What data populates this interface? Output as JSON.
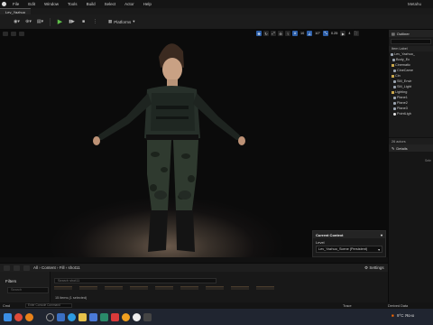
{
  "app": {
    "title": "Metahu",
    "menu": [
      "File",
      "Edit",
      "Window",
      "Tools",
      "Build",
      "Select",
      "Actor",
      "Help"
    ]
  },
  "tabs": [
    {
      "label": "Lev_Yazhuo"
    }
  ],
  "toolbar": {
    "platforms_label": "Platforms",
    "icons": [
      "select-mode-icon",
      "add-actor-icon",
      "blueprint-icon",
      "play-icon",
      "step-icon",
      "stop-icon",
      "more-icon"
    ]
  },
  "viewport": {
    "controls": {
      "grid_snap": "10",
      "rotation_snap": "10°",
      "scale_snap": "0.25",
      "camera_speed": "4"
    },
    "context": {
      "title": "Current Context",
      "level_label": "Level",
      "level_value": "Lev_Yazhuo_Scene (Persistent)"
    }
  },
  "outliner": {
    "title": "Outliner",
    "column": "Item Label",
    "items": [
      {
        "label": "Lev_Yazhuo_",
        "icon": "actor",
        "indent": 2
      },
      {
        "label": "Body_Ec",
        "icon": "actor",
        "indent": 4
      },
      {
        "label": "Cinematic",
        "icon": "folder",
        "indent": 3
      },
      {
        "label": "CineCame",
        "icon": "actor",
        "indent": 5
      },
      {
        "label": "Cin",
        "icon": "folder",
        "indent": 3
      },
      {
        "label": "SM_Envir",
        "icon": "actor",
        "indent": 5
      },
      {
        "label": "SM_Light",
        "icon": "actor",
        "indent": 5
      },
      {
        "label": "Lighting",
        "icon": "folder",
        "indent": 3
      },
      {
        "label": "Plane1",
        "icon": "actor",
        "indent": 5
      },
      {
        "label": "Plane2",
        "icon": "actor",
        "indent": 5
      },
      {
        "label": "Plane3",
        "icon": "actor",
        "indent": 5
      },
      {
        "label": "PointLigh",
        "icon": "light",
        "indent": 5
      }
    ],
    "footer": "26 actors"
  },
  "details": {
    "title": "Details",
    "note": "Sele"
  },
  "content_browser": {
    "path": [
      "All",
      "Content",
      "Fill",
      "shot11"
    ],
    "settings_label": "Settings",
    "filters_label": "Filters",
    "filter_search_placeholder": "Search",
    "search_placeholder": "Search shot11",
    "count": "15 items (1 selected)"
  },
  "statusbar": {
    "left": "Cmd",
    "cmd_placeholder": "Enter Console Command",
    "trace": "Trace",
    "derived": "Derived Data"
  },
  "taskbar": {
    "temperature": "9°C",
    "weather": "Ясно",
    "warn": "■"
  },
  "colors": {
    "accent": "#2d5fa8",
    "play": "#5fbf4a",
    "folder": "#c8a64b"
  }
}
